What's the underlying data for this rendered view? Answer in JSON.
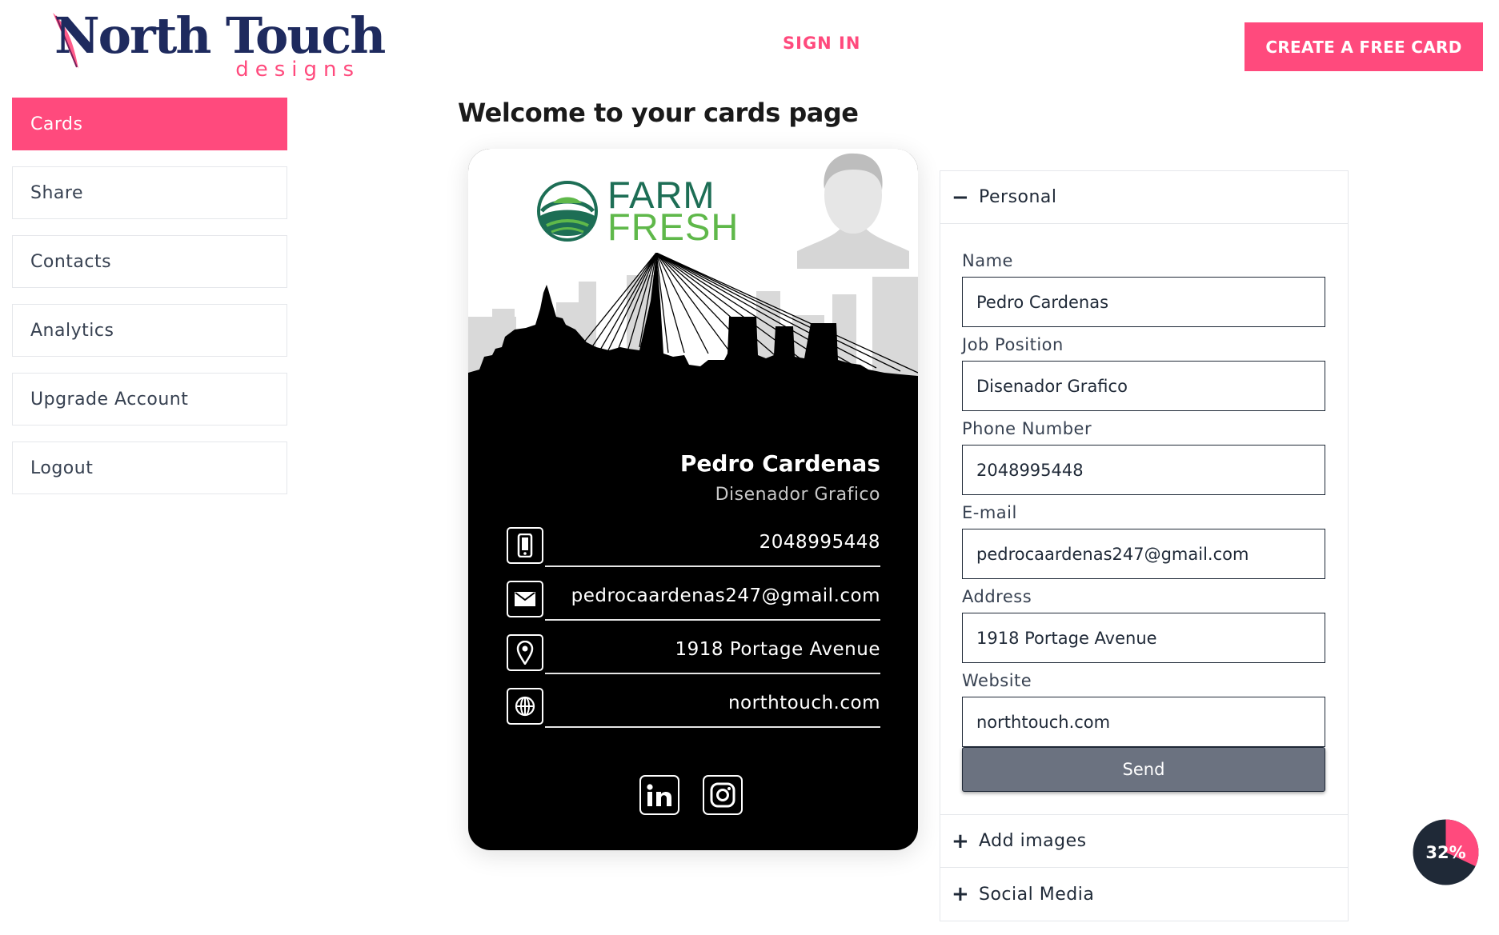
{
  "header": {
    "logo_title": "North Touch",
    "logo_subtitle": "designs",
    "signin_label": "SIGN IN",
    "create_label": "CREATE A FREE CARD"
  },
  "sidebar": {
    "items": [
      {
        "label": "Cards",
        "active": true
      },
      {
        "label": "Share"
      },
      {
        "label": "Contacts"
      },
      {
        "label": "Analytics"
      },
      {
        "label": "Upgrade Account"
      },
      {
        "label": "Logout"
      }
    ]
  },
  "page": {
    "title": "Welcome to your cards page"
  },
  "card": {
    "brand_line1": "FARM",
    "brand_line2": "FRESH",
    "name": "Pedro Cardenas",
    "job": "Disenador Grafico",
    "phone": "2048995448",
    "email": "pedrocaardenas247@gmail.com",
    "address": "1918 Portage Avenue",
    "website": "northtouch.com",
    "icons": [
      "phone-icon",
      "mail-icon",
      "location-pin-icon",
      "globe-icon",
      "linkedin-icon",
      "instagram-icon"
    ]
  },
  "form": {
    "section_personal": "Personal",
    "labels": {
      "name": "Name",
      "job": "Job Position",
      "phone": "Phone Number",
      "email": "E-mail",
      "address": "Address",
      "website": "Website"
    },
    "values": {
      "name": "Pedro Cardenas",
      "job": "Disenador Grafico",
      "phone": "2048995448",
      "email": "pedrocaardenas247@gmail.com",
      "address": "1918 Portage Avenue",
      "website": "northtouch.com"
    },
    "send_label": "Send",
    "section_images": "Add images",
    "section_social": "Social Media"
  },
  "progress": {
    "value": 32,
    "label": "32%"
  },
  "colors": {
    "accent": "#ff4a7d",
    "navy": "#1e2a5e",
    "send": "#6b7280",
    "progress_bg": "#1f2937"
  }
}
